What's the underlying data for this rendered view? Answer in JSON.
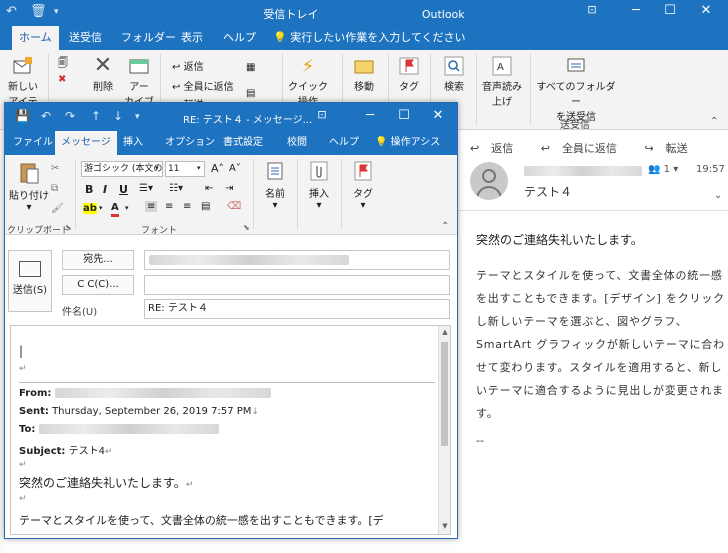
{
  "main": {
    "title": "受信トレイ",
    "app": "Outlook",
    "tabs": [
      "ホーム",
      "送受信",
      "フォルダー",
      "表示",
      "ヘルプ",
      "実行したい作業を入力してください"
    ],
    "active_tab": "ホーム",
    "ribbon": {
      "new": "新しい",
      "new2": "アイテム",
      "delete": "削除",
      "archive": "アー",
      "archive2": "カイブ",
      "reply": "返信",
      "reply_all": "全員に返信",
      "forward": "転送",
      "quick": "クイック",
      "quick2": "操作",
      "move": "移動",
      "tags": "タグ",
      "search": "検索",
      "read_aloud": "音声読み",
      "read_aloud2": "上げ",
      "send_all": "すべてのフォルダー",
      "send_all2": "を送受信",
      "group_sendrecv": "送受信"
    }
  },
  "reading_pane": {
    "reply": "返信",
    "reply_all": "全員に返信",
    "forward": "転送",
    "subject": "テスト４",
    "people_count": "1",
    "time": "19:57",
    "greeting": "突然のご連絡失礼いたします。",
    "body": "テーマとスタイルを使って、文書全体の統一感を出すこともできます。[デザイン] をクリックし新しいテーマを選ぶと、図やグラフ、SmartArt グラフィックが新しいテーマに合わせて変わります。スタイルを適用すると、新しいテーマに適合するように見出しが変更されます。",
    "signature": "--"
  },
  "compose": {
    "title": "RE: テスト４ - メッセージ...",
    "tabs": [
      "ファイル",
      "メッセージ",
      "挿入",
      "オプション",
      "書式設定",
      "校閲",
      "ヘルプ",
      "操作アシス"
    ],
    "active_tab": "メッセージ",
    "ribbon": {
      "paste": "貼り付け",
      "font_name": "游ゴシック (本文のフ",
      "font_size": "11",
      "name_btn": "名前",
      "insert_btn": "挿入",
      "tags_btn": "タグ",
      "group_clipboard": "クリップボード",
      "group_font": "フォント"
    },
    "send": "送信(S)",
    "to_btn": "宛先...",
    "cc_btn": "C C(C)...",
    "subject_label": "件名(U)",
    "subject_value": "RE: テスト４",
    "body": {
      "from_label": "From:",
      "sent_label": "Sent:",
      "sent_value": "Thursday, September 26, 2019 7:57 PM",
      "to_label": "To:",
      "subject_label": "Subject:",
      "subject_value": "テスト4",
      "greeting": "突然のご連絡失礼いたします。",
      "text": "テーマとスタイルを使って、文書全体の統一感を出すこともできます。[デ"
    }
  }
}
